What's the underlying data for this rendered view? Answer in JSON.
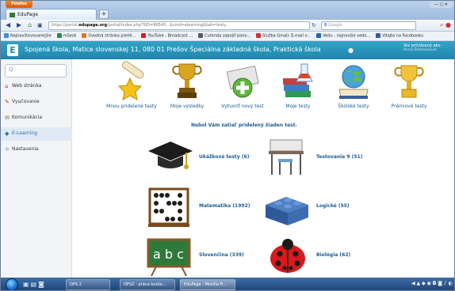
{
  "browser": {
    "app_button": "Firefox",
    "tab_title": "EduPage",
    "new_tab": "+",
    "url_prefix": "https://portal.",
    "url_domain": "edupage.org",
    "url_rest": "/portal/index.php?SID=96540...&cmd=elearning&tab=testy...",
    "search_placeholder": "Google"
  },
  "bookmarks": [
    {
      "label": "Najnavštevovanejšie",
      "color": "#4a8bd4"
    },
    {
      "label": "mSesk",
      "color": "#2c8a3c"
    },
    {
      "label": "Úvodná stránka prehli...",
      "color": "#e07a1a"
    },
    {
      "label": "YouTube - Broadcast ...",
      "color": "#cc2222"
    },
    {
      "label": "Cutenda zapojiť pano...",
      "color": "#5a5a5a"
    },
    {
      "label": "Služba Gmail: E-mail o...",
      "color": "#c33"
    },
    {
      "label": "Vedu - najnovšie vedo...",
      "color": "#2266aa"
    },
    {
      "label": "Vitajte na Facebooku",
      "color": "#3b5998"
    }
  ],
  "site": {
    "logo": "E",
    "school_name": "Spojená škola, Matice slovenskej 11, 080 01 Prešov Špeciálna základná škola, Praktická škola",
    "login_title": "Ste prihlásený ako:",
    "login_user": "Anna Šalamonová"
  },
  "sidebar": {
    "search_placeholder": "Q",
    "items": [
      {
        "label": "Web stránka",
        "icon": "house-icon",
        "glyph": "⌂",
        "color": "#c33"
      },
      {
        "label": "Vyučovanie",
        "icon": "pencil-icon",
        "glyph": "✎",
        "color": "#c33"
      },
      {
        "label": "Komunikácia",
        "icon": "chat-icon",
        "glyph": "✉",
        "color": "#2a8a3c"
      },
      {
        "label": "E-Learning",
        "icon": "elearning-icon",
        "glyph": "◆",
        "color": "#2a6fa8"
      },
      {
        "label": "Nastavenia",
        "icon": "gear-icon",
        "glyph": "✲",
        "color": "#9ab"
      }
    ]
  },
  "main": {
    "top_actions": [
      {
        "label": "Mnou pridelené testy",
        "icon": "diploma-star-icon"
      },
      {
        "label": "Moje výsledky",
        "icon": "trophy-icon"
      },
      {
        "label": "Vytvoriť nový test",
        "icon": "new-test-icon"
      },
      {
        "label": "Moje testy",
        "icon": "books-flask-icon"
      },
      {
        "label": "Školské testy",
        "icon": "globe-book-icon"
      },
      {
        "label": "Prémiové testy",
        "icon": "gold-trophy-icon"
      }
    ],
    "notice": "Nebol Vám zatiaľ pridelený žiaden test.",
    "categories": [
      {
        "label": "Ukážkové testy (6)",
        "icon": "graduation-cap-icon"
      },
      {
        "label": "Testovanie 9 (51)",
        "icon": "school-desk-icon"
      },
      {
        "label": "Matematika (1992)",
        "icon": "abacus-icon"
      },
      {
        "label": "Logické (55)",
        "icon": "puzzle-blocks-icon"
      },
      {
        "label": "Slovenčina (339)",
        "icon": "chalkboard-abc-icon"
      },
      {
        "label": "Biológia (62)",
        "icon": "ladybug-icon"
      }
    ]
  },
  "taskbar": {
    "items": [
      {
        "label": "OPS 2"
      },
      {
        "label": "OPSZ - práca budúc..."
      },
      {
        "label": "EduPage - Mozilla Fi..."
      }
    ]
  }
}
